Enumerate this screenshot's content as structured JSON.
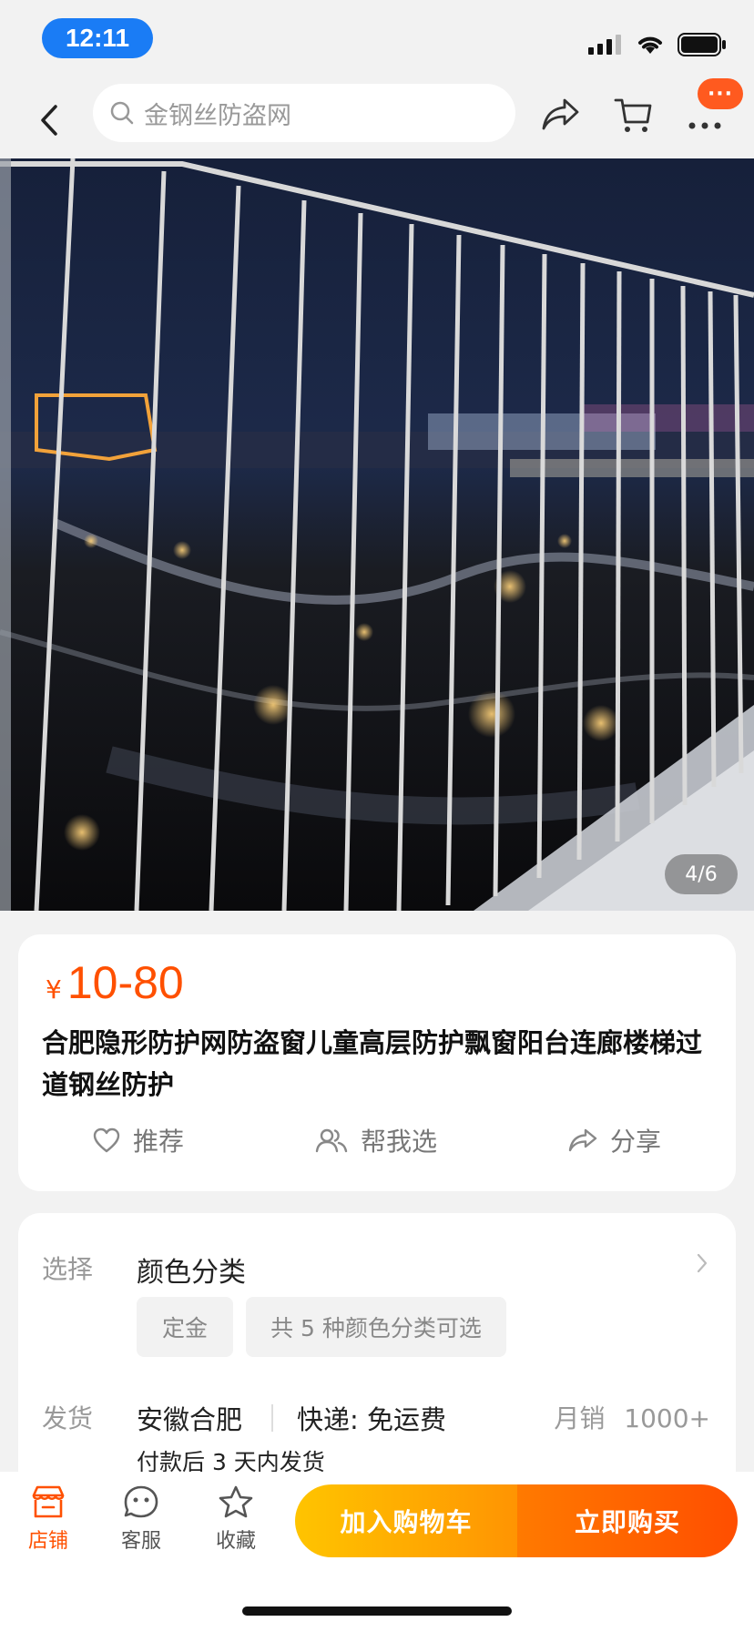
{
  "status_bar": {
    "time": "12:11"
  },
  "search": {
    "placeholder": "金钢丝防盗网"
  },
  "nav": {
    "more_badge": "···"
  },
  "gallery": {
    "counter": "4/6"
  },
  "product": {
    "price_currency": "¥",
    "price": "10-80",
    "title": "合肥隐形防护网防盗窗儿童高层防护飘窗阳台连廊楼梯过道钢丝防护",
    "actions": {
      "recommend": "推荐",
      "help_choose": "帮我选",
      "share": "分享"
    }
  },
  "options": {
    "select_label": "选择",
    "select_title": "颜色分类",
    "chips": [
      "定金",
      "共 5 种颜色分类可选"
    ]
  },
  "shipping": {
    "label": "发货",
    "location": "安徽合肥",
    "express": "快递: 免运费",
    "monthly_sales_label": "月销",
    "monthly_sales": "1000+",
    "note": "付款后 3 天内发货"
  },
  "bottom_bar": {
    "store": "店铺",
    "service": "客服",
    "favorite": "收藏",
    "add_to_cart": "加入购物车",
    "buy_now": "立即购买"
  },
  "colors": {
    "accent": "#ff5000",
    "cart_gradient": "#ffc400",
    "buy_gradient": "#ff4e00",
    "time_pill": "#1a7cf5"
  }
}
